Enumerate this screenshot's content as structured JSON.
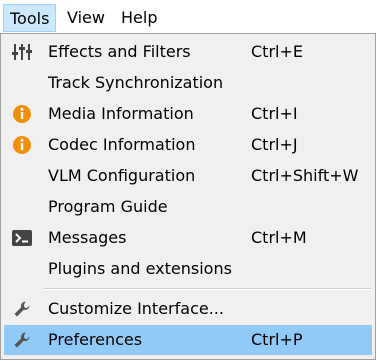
{
  "menubar": {
    "items": [
      {
        "label": "Tools"
      },
      {
        "label": "View"
      },
      {
        "label": "Help"
      }
    ]
  },
  "menu": {
    "items": [
      {
        "label": "Effects and Filters",
        "shortcut": "Ctrl+E",
        "icon": "equalizer-sliders-icon"
      },
      {
        "label": "Track Synchronization",
        "shortcut": ""
      },
      {
        "label": "Media Information",
        "shortcut": "Ctrl+I",
        "icon": "info-icon"
      },
      {
        "label": "Codec Information",
        "shortcut": "Ctrl+J",
        "icon": "info-icon"
      },
      {
        "label": "VLM Configuration",
        "shortcut": "Ctrl+Shift+W"
      },
      {
        "label": "Program Guide",
        "shortcut": ""
      },
      {
        "label": "Messages",
        "shortcut": "Ctrl+M",
        "icon": "terminal-icon"
      },
      {
        "label": "Plugins and extensions",
        "shortcut": ""
      },
      {
        "label": "Customize Interface...",
        "shortcut": "",
        "icon": "wrench-icon"
      },
      {
        "label": "Preferences",
        "shortcut": "Ctrl+P",
        "icon": "wrench-icon",
        "selected": true
      }
    ]
  },
  "colors": {
    "menu_background": "#f0f0f0",
    "active_menubar_bg": "#cce8ff",
    "selected_item_bg": "#91c9f7",
    "info_icon": "#f0900a",
    "icon_gray": "#444444"
  }
}
